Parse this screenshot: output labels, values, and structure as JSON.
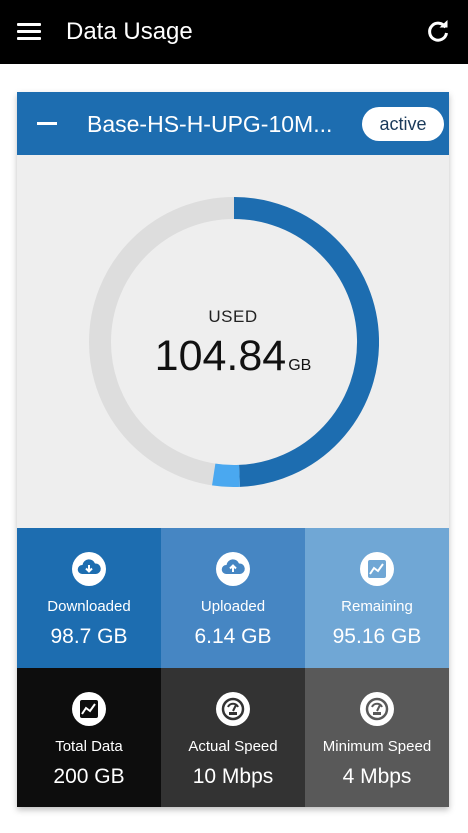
{
  "app_bar": {
    "title": "Data Usage",
    "menu_icon": "menu-icon",
    "refresh_icon": "refresh-icon"
  },
  "plan_card": {
    "plan_name": "Base-HS-H-UPG-10M...",
    "status": "active",
    "collapse_icon": "minus-icon",
    "usage": {
      "label": "USED",
      "value": "104.84",
      "unit": "GB",
      "used_fraction": 0.5242
    },
    "stats": [
      {
        "label": "Downloaded",
        "value": "98.7 GB",
        "icon": "cloud-download-icon",
        "color": "#1d6db0"
      },
      {
        "label": "Uploaded",
        "value": "6.14 GB",
        "icon": "cloud-upload-icon",
        "color": "#4686c3"
      },
      {
        "label": "Remaining",
        "value": "95.16 GB",
        "icon": "chart-icon",
        "color": "#70a7d5"
      },
      {
        "label": "Total Data",
        "value": "200 GB",
        "icon": "chart-icon",
        "color": "#0d0d0d"
      },
      {
        "label": "Actual Speed",
        "value": "10 Mbps",
        "icon": "speedometer-icon",
        "color": "#333333"
      },
      {
        "label": "Minimum Speed",
        "value": "4 Mbps",
        "icon": "speedometer-icon",
        "color": "#595959"
      }
    ]
  },
  "colors": {
    "app_bar": "#000000",
    "header": "#1d6db0",
    "gauge_track": "#dddddd",
    "gauge_download": "#1d6db0",
    "gauge_upload": "#4aa8f0"
  }
}
